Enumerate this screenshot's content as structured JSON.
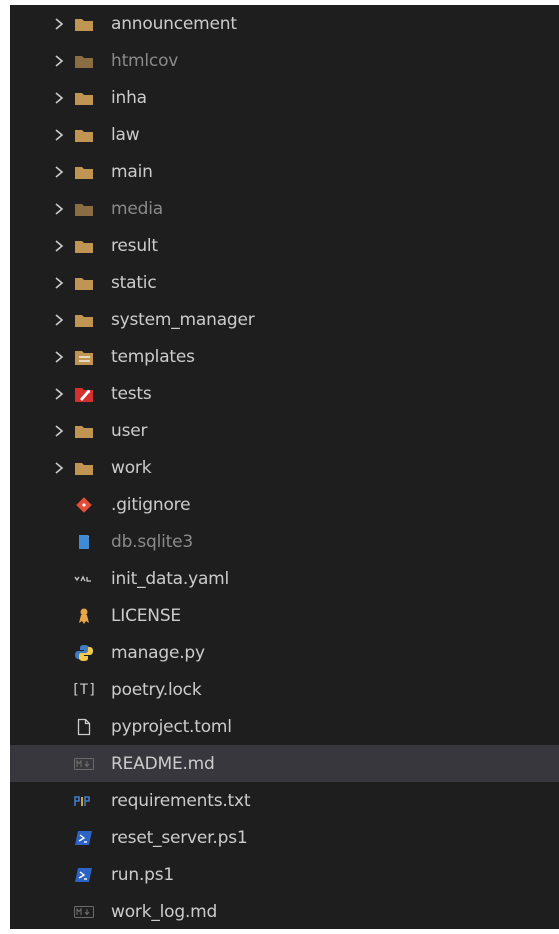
{
  "explorer": {
    "folders": [
      {
        "label": "announcement",
        "icon": "folder-icon",
        "dim": false
      },
      {
        "label": "htmlcov",
        "icon": "folder-icon",
        "dim": true
      },
      {
        "label": "inha",
        "icon": "folder-icon",
        "dim": false
      },
      {
        "label": "law",
        "icon": "folder-icon",
        "dim": false
      },
      {
        "label": "main",
        "icon": "folder-icon",
        "dim": false
      },
      {
        "label": "media",
        "icon": "folder-icon",
        "dim": true
      },
      {
        "label": "result",
        "icon": "folder-icon",
        "dim": false
      },
      {
        "label": "static",
        "icon": "folder-icon",
        "dim": false
      },
      {
        "label": "system_manager",
        "icon": "folder-icon",
        "dim": false
      },
      {
        "label": "templates",
        "icon": "templates-folder-icon",
        "dim": false
      },
      {
        "label": "tests",
        "icon": "tests-folder-icon",
        "dim": false
      },
      {
        "label": "user",
        "icon": "folder-icon",
        "dim": false
      },
      {
        "label": "work",
        "icon": "folder-icon",
        "dim": false
      }
    ],
    "files": [
      {
        "label": ".gitignore",
        "icon": "git-icon",
        "dim": false
      },
      {
        "label": "db.sqlite3",
        "icon": "database-icon",
        "dim": true
      },
      {
        "label": "init_data.yaml",
        "icon": "yaml-icon",
        "dim": false
      },
      {
        "label": "LICENSE",
        "icon": "license-icon",
        "dim": false
      },
      {
        "label": "manage.py",
        "icon": "python-icon",
        "dim": false
      },
      {
        "label": "poetry.lock",
        "icon": "lock-file-icon",
        "dim": false
      },
      {
        "label": "pyproject.toml",
        "icon": "file-icon",
        "dim": false
      },
      {
        "label": "README.md",
        "icon": "markdown-icon",
        "dim": false,
        "selected": true
      },
      {
        "label": "requirements.txt",
        "icon": "pip-icon",
        "dim": false
      },
      {
        "label": "reset_server.ps1",
        "icon": "powershell-icon",
        "dim": false
      },
      {
        "label": "run.ps1",
        "icon": "powershell-icon",
        "dim": false
      },
      {
        "label": "work_log.md",
        "icon": "markdown-icon",
        "dim": false
      }
    ]
  },
  "colors": {
    "background": "#1e1e1e",
    "selected_row": "#37373d",
    "text": "#cccccc",
    "dim_text": "#8a8a8a",
    "folder": "#c09553",
    "git": "#e44d37",
    "tests": "#d53030",
    "python_blue": "#3f7cc4",
    "python_yellow": "#f3c94a",
    "powershell": "#2b64c4",
    "license": "#e8a54a"
  }
}
